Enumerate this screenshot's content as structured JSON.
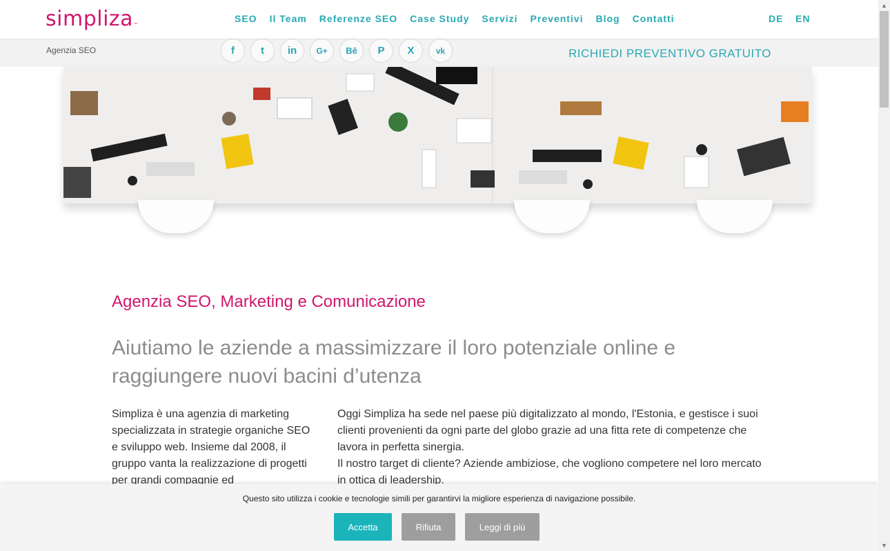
{
  "brand": {
    "logo": "simpliza",
    "tm": "™"
  },
  "nav": [
    "SEO",
    "Il Team",
    "Referenze SEO",
    "Case Study",
    "Servizi",
    "Preventivi",
    "Blog",
    "Contatti"
  ],
  "languages": [
    "DE",
    "EN"
  ],
  "subbar": {
    "agency_label": "Agenzia SEO",
    "cta": "RICHIEDI PREVENTIVO GRATUITO",
    "social_icons": [
      "facebook-icon",
      "twitter-icon",
      "linkedin-icon",
      "google-plus-icon",
      "behance-icon",
      "pinterest-icon",
      "xing-icon",
      "vk-icon"
    ],
    "social_glyphs": [
      "f",
      "t",
      "in",
      "G+",
      "Bē",
      "P",
      "X",
      "vk"
    ]
  },
  "content": {
    "section_title": "Agenzia SEO, Marketing e Comunicazione",
    "headline": "Aiutiamo le aziende a massimizzare il loro potenziale online e raggiungere nuovi bacini d’utenza",
    "col1": "Simpliza è una agenzia di marketing specializzata in strategie organiche SEO e sviluppo web. Insieme dal 2008, il gruppo vanta la realizzazione di progetti per grandi compagnie ed",
    "col2_p1": "Oggi Simpliza ha sede nel paese più digitalizzato al mondo, l'Estonia, e gestisce i suoi clienti provenienti da ogni parte del globo grazie ad una fitta rete di competenze che lavora in perfetta sinergia.",
    "col2_p2": "Il nostro target di cliente? Aziende ambiziose, che vogliono competere nel loro mercato in ottica di leadership."
  },
  "cookie": {
    "message": "Questo sito utilizza i cookie e tecnologie simili per garantirvi la migliore esperienza di navigazione possibile.",
    "accept": "Accetta",
    "reject": "Rifiuta",
    "more": "Leggi di più"
  },
  "colors": {
    "accent": "#27a9b3",
    "brand": "#d1166c",
    "gray_button": "#9e9e9e"
  }
}
